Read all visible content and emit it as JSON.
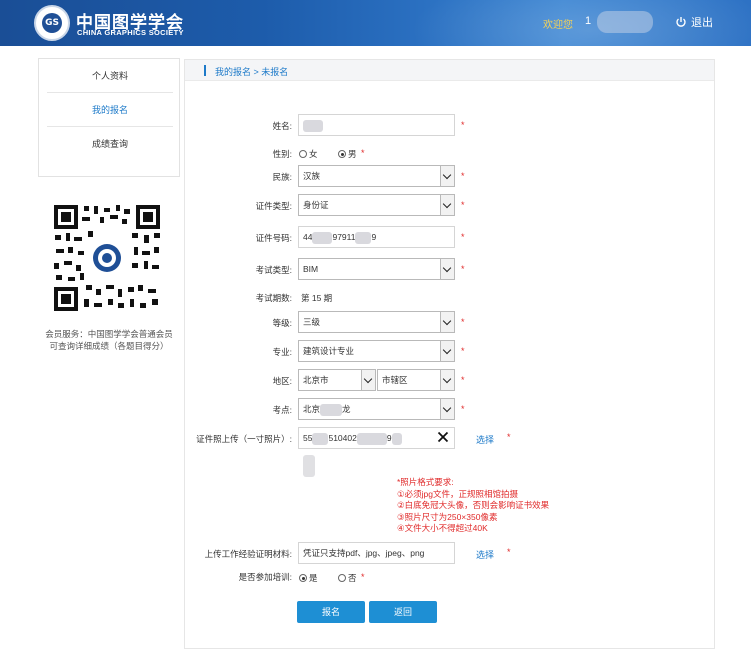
{
  "header": {
    "logo_mark": "GS",
    "logo_cn": "中国图学学会",
    "logo_en": "CHINA GRAPHICS SOCIETY",
    "welcome": "欢迎您",
    "user_id": "1",
    "logout": "退出"
  },
  "sidebar": {
    "items": [
      {
        "label": "个人资料"
      },
      {
        "label": "我的报名"
      },
      {
        "label": "成绩查询"
      }
    ],
    "member_note": "会员服务：中国图学学会普通会员可查询详细成绩（各题目得分）"
  },
  "breadcrumb": {
    "text": "我的报名 > 未报名"
  },
  "form": {
    "name_label": "姓名:",
    "gender_label": "性别:",
    "gender_female": "女",
    "gender_male": "男",
    "ethnicity_label": "民族:",
    "ethnicity_value": "汉族",
    "id_type_label": "证件类型:",
    "id_type_value": "身份证",
    "id_number_label": "证件号码:",
    "id_number_part1": "44",
    "id_number_part2": "97911",
    "id_number_part3": "9",
    "exam_type_label": "考试类型:",
    "exam_type_value": "BIM",
    "exam_period_label": "考试期数:",
    "exam_period_value": "第 15 期",
    "level_label": "等级:",
    "level_value": "三级",
    "major_label": "专业:",
    "major_value": "建筑设计专业",
    "region_label": "地区:",
    "city_value": "北京市",
    "district_value": "市辖区",
    "site_label": "考点:",
    "site_part1": "北京",
    "site_part2": "龙",
    "photo_label": "证件照上传（一寸照片）:",
    "photo_file_part1": "55",
    "photo_file_part2": "510402",
    "photo_file_part3": "9",
    "choose_link": "选择",
    "photo_rules": [
      "*照片格式要求:",
      "①必须jpg文件，正规照相馆拍摄",
      "②白底免冠大头像，否则会影响证书效果",
      "③照片尺寸为250×350像素",
      "④文件大小不得超过40K"
    ],
    "cert_label": "上传工作经验证明材料:",
    "cert_placeholder": "凭证只支持pdf、jpg、jpeg、png",
    "training_label": "是否参加培训:",
    "training_yes": "是",
    "training_no": "否",
    "required_mark": "*"
  },
  "buttons": {
    "submit": "报名",
    "back": "返回"
  },
  "colors": {
    "header_bg": "#1d5cab",
    "accent": "#1d7ac9",
    "button": "#1e8fd4",
    "required": "#e02a2a",
    "welcome": "#f5d257"
  }
}
